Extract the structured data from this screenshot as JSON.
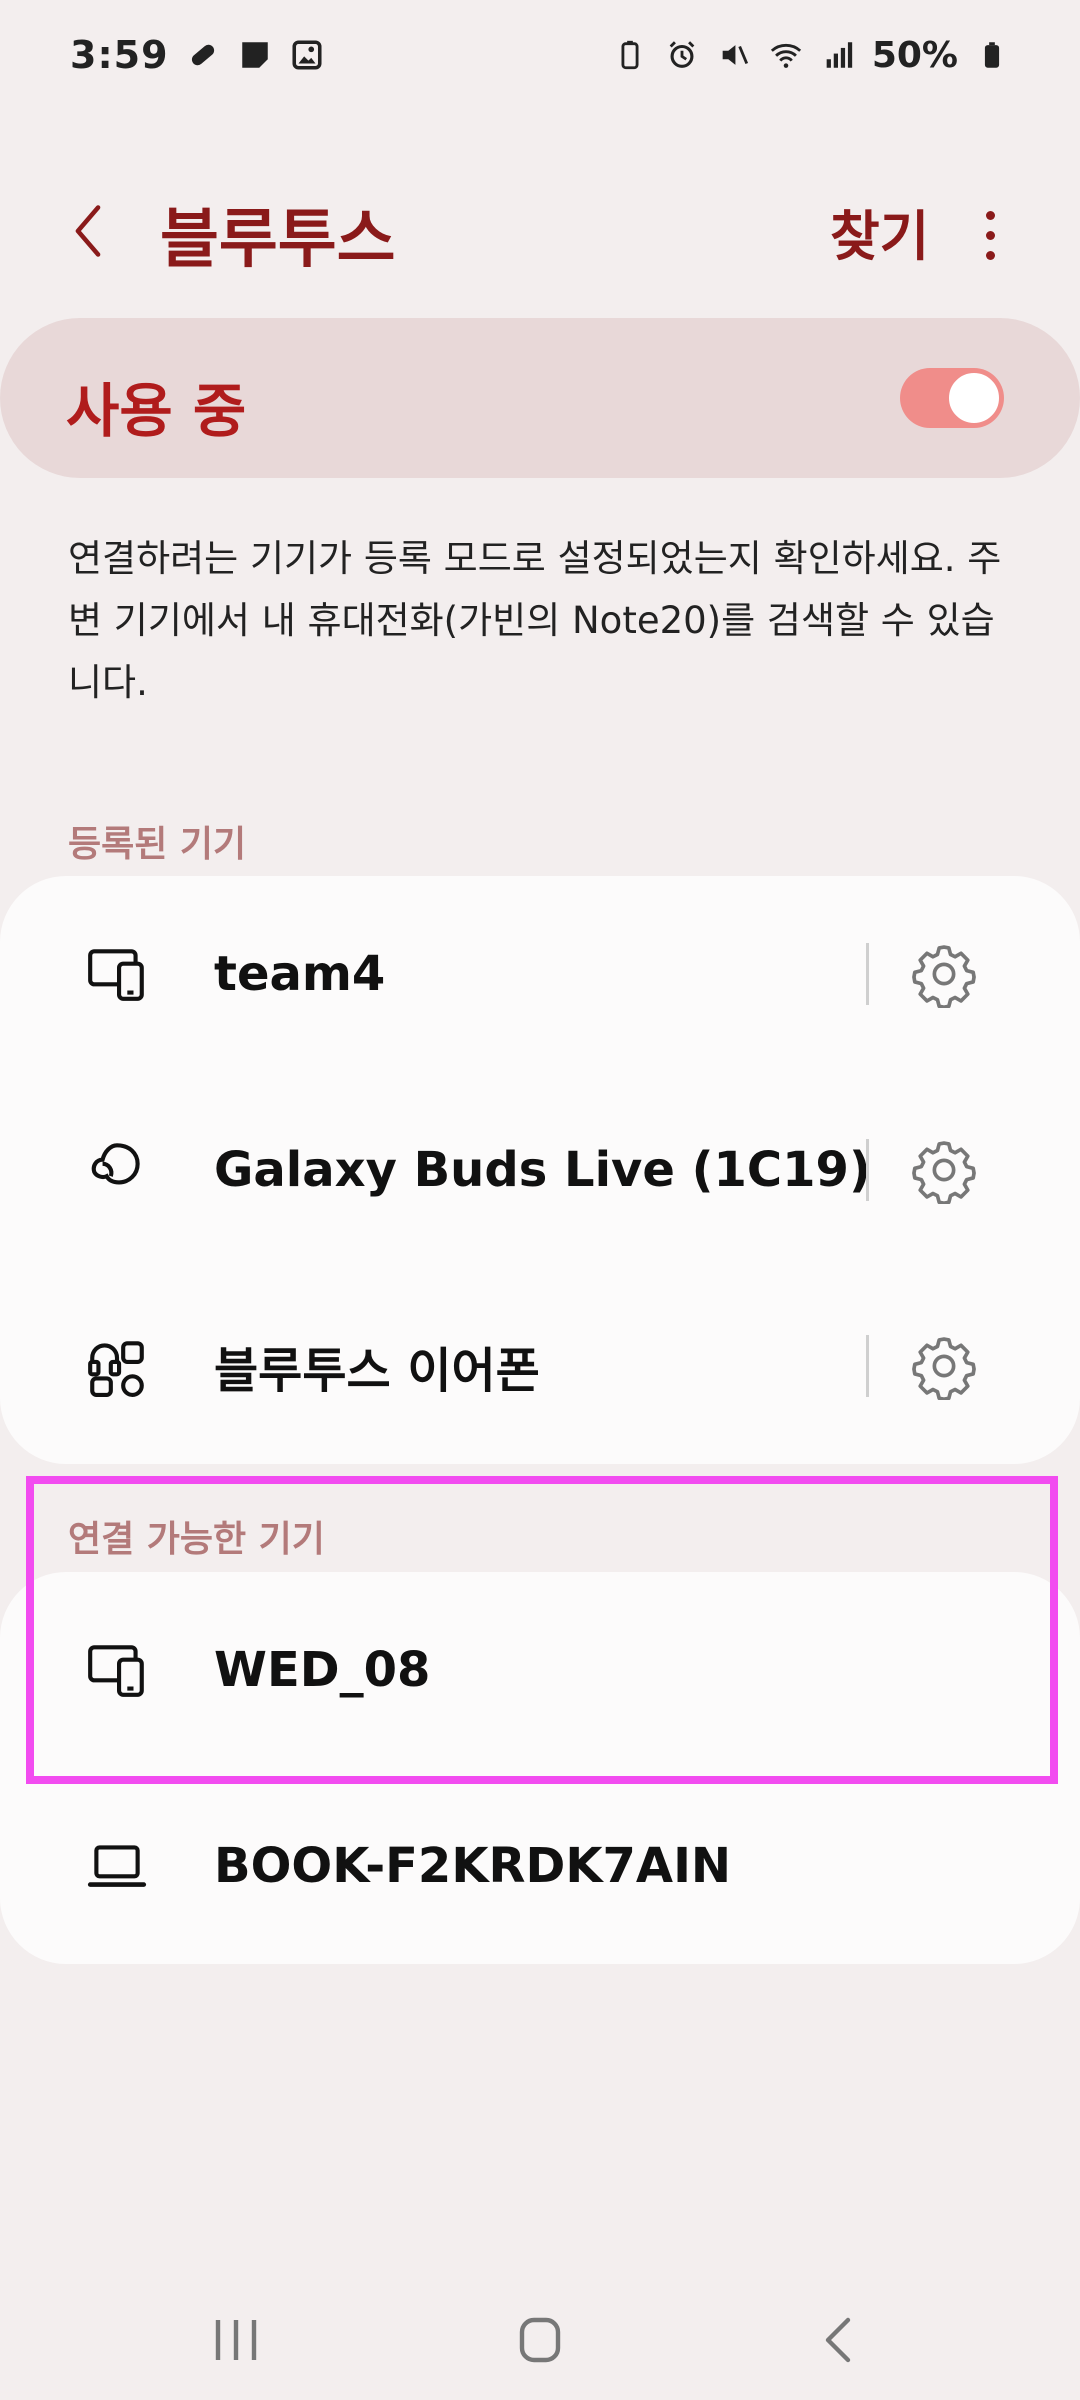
{
  "status_bar": {
    "time": "3:59",
    "battery_percent": "50%",
    "left_icons": [
      "pill-icon",
      "sticky-note-icon",
      "image-icon"
    ],
    "right_icons": [
      "battery-saver-icon",
      "alarm-icon",
      "mute-icon",
      "wifi-icon",
      "signal-icon",
      "battery-icon"
    ]
  },
  "app_bar": {
    "title": "블루투스",
    "find_label": "찾기"
  },
  "master_toggle": {
    "label": "사용 중",
    "enabled": true,
    "accent_color": "#f08d8a"
  },
  "description": "연결하려는 기기가 등록 모드로 설정되었는지 확인하세요. 주변 기기에서 내 휴대전화(가빈의 Note20)를 검색할 수 있습니다.",
  "paired_section": {
    "header": "등록된 기기",
    "devices": [
      {
        "name": "team4",
        "icon": "phone-tablet-icon"
      },
      {
        "name": "Galaxy Buds Live (1C19)",
        "icon": "earbuds-icon"
      },
      {
        "name": "블루투스 이어폰",
        "icon": "headset-apps-icon"
      }
    ]
  },
  "available_section": {
    "header": "연결 가능한 기기",
    "devices": [
      {
        "name": "WED_08",
        "icon": "phone-tablet-icon"
      },
      {
        "name": "BOOK-F2KRDK7AIN",
        "icon": "laptop-icon"
      }
    ]
  },
  "colors": {
    "title": "#8a1a1a",
    "master_label": "#b01c1c",
    "section_header": "#b37a7a",
    "highlight": "#f24cf0",
    "background": "#f3eeee"
  }
}
